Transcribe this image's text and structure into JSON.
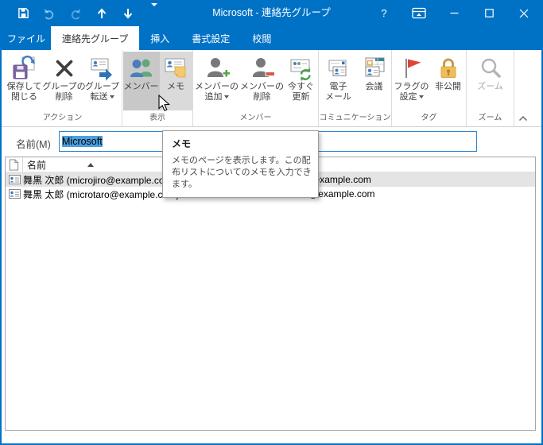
{
  "accent": "#0072C6",
  "window": {
    "title": "Microsoft - 連絡先グループ"
  },
  "qat": {
    "icons": [
      "save-icon",
      "undo-icon",
      "redo-icon",
      "move-up-icon",
      "move-down-icon",
      "customize-qat-icon"
    ]
  },
  "window_controls": {
    "help": "?",
    "icons": [
      "ribbon-display-options-icon",
      "minimize-icon",
      "maximize-icon",
      "close-icon"
    ]
  },
  "tabs": [
    {
      "label": "ファイル"
    },
    {
      "label": "連絡先グループ",
      "active": true
    },
    {
      "label": "挿入"
    },
    {
      "label": "書式設定"
    },
    {
      "label": "校閲"
    }
  ],
  "ribbon": {
    "groups": [
      {
        "label": "アクション",
        "buttons": [
          {
            "line1": "保存して",
            "line2": "閉じる",
            "icon": "save-and-close"
          },
          {
            "line1": "グループの",
            "line2": "削除",
            "icon": "delete-group"
          },
          {
            "line1": "グループ",
            "line2": "転送",
            "icon": "forward-group",
            "dropdown": true
          }
        ]
      },
      {
        "label": "表示",
        "buttons": [
          {
            "line1": "メンバー",
            "icon": "members",
            "state": "selected"
          },
          {
            "line1": "メモ",
            "icon": "notes",
            "state": "hover"
          }
        ]
      },
      {
        "label": "メンバー",
        "buttons": [
          {
            "line1": "メンバーの",
            "line2": "追加",
            "icon": "add-members",
            "dropdown": true
          },
          {
            "line1": "メンバーの",
            "line2": "削除",
            "icon": "remove-member"
          },
          {
            "line1": "今すぐ",
            "line2": "更新",
            "icon": "update-now"
          }
        ]
      },
      {
        "label": "コミュニケーション",
        "buttons": [
          {
            "line1": "電子",
            "line2": "メール",
            "icon": "email"
          },
          {
            "line1": "会議",
            "icon": "meeting"
          }
        ]
      },
      {
        "label": "タグ",
        "buttons": [
          {
            "line1": "フラグの",
            "line2": "設定",
            "icon": "follow-up-flag",
            "dropdown": true
          },
          {
            "line1": "非公開",
            "icon": "private-lock"
          }
        ]
      },
      {
        "label": "ズーム",
        "buttons": [
          {
            "line1": "ズーム",
            "icon": "zoom",
            "disabled": true
          }
        ]
      }
    ]
  },
  "form": {
    "name_label": "名前(M)",
    "name_value": "Microsoft"
  },
  "tooltip": {
    "title": "メモ",
    "body": "メモのページを表示します。この配布リストについてのメモを入力できます。"
  },
  "list": {
    "name_header": "名前",
    "rows": [
      {
        "name": "舞黒 次郎 (microjiro@example.com)",
        "email": "microjiro@example.com",
        "selected": true
      },
      {
        "name": "舞黒 太郎 (microtaro@example.com)",
        "email": "microtaro@example.com",
        "selected": false
      }
    ]
  }
}
